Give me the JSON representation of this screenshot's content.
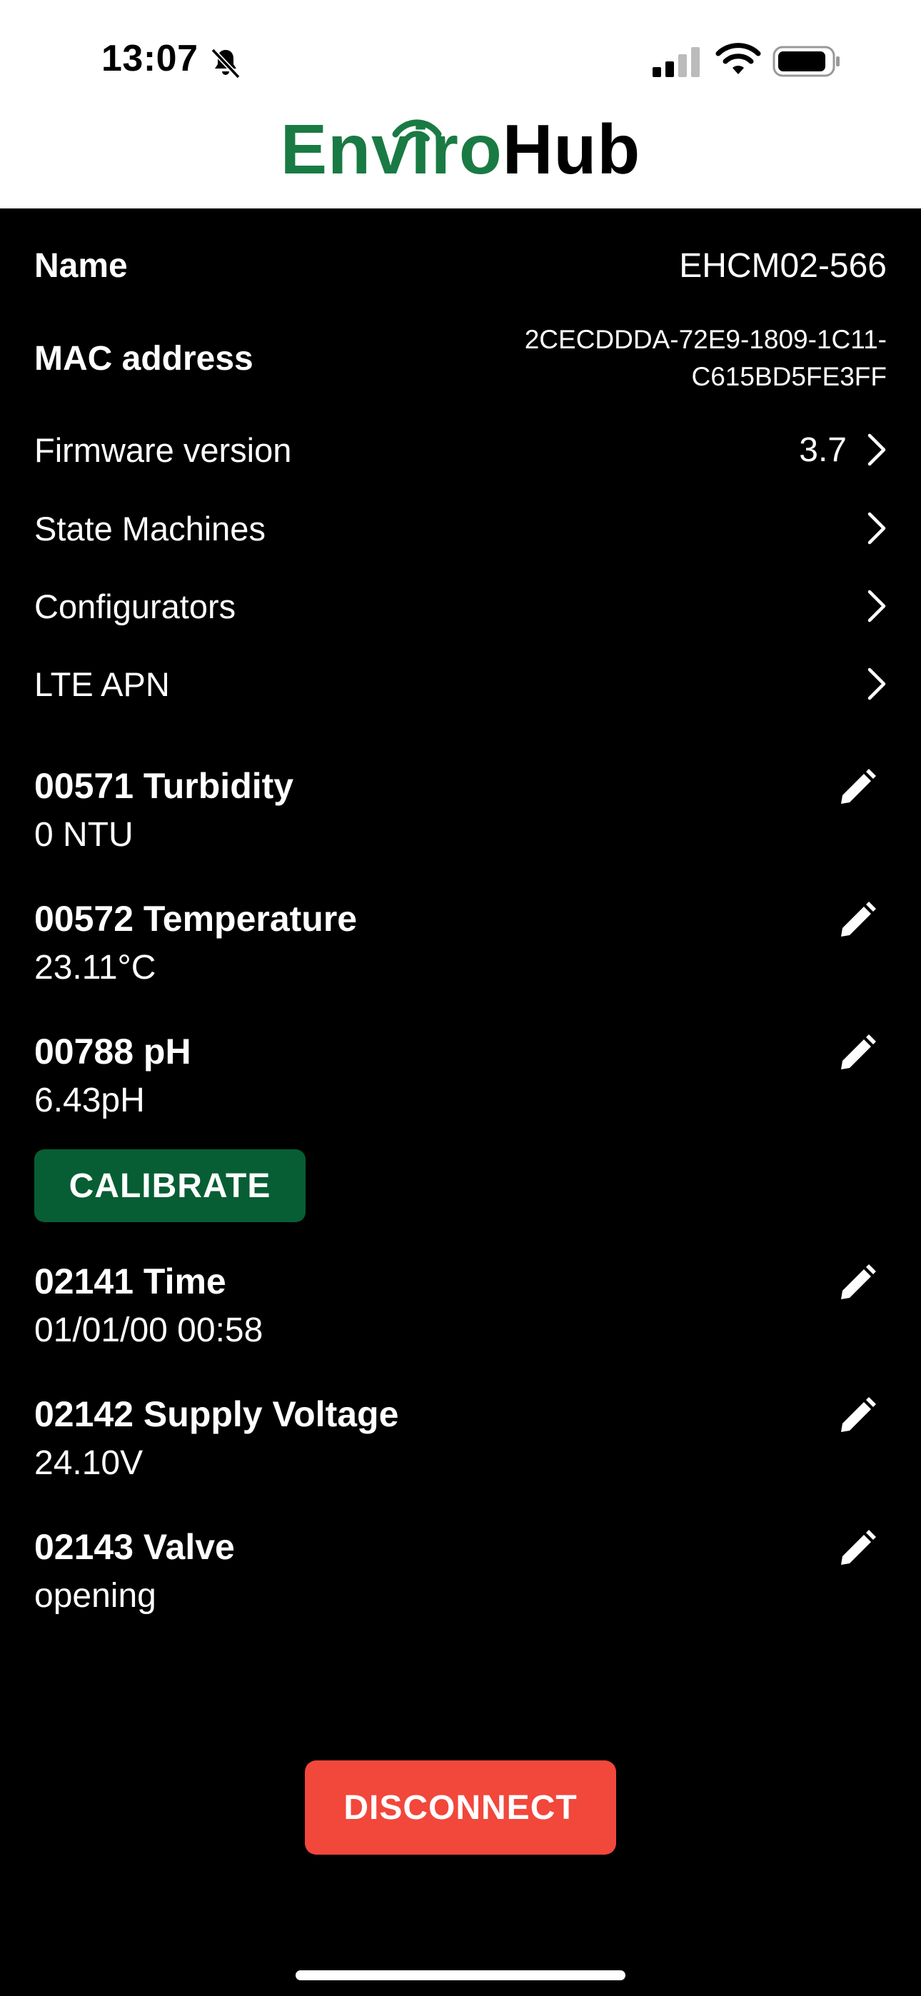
{
  "status_bar": {
    "time": "13:07",
    "icons": [
      "bell-slash-icon",
      "cellular-signal-icon",
      "wifi-icon",
      "battery-icon"
    ]
  },
  "header": {
    "logo_part1": "Enviro",
    "logo_part2": "Hub"
  },
  "colors": {
    "brand_green": "#1a7a43",
    "calibrate_bg": "#075e34",
    "disconnect_bg": "#f2473b",
    "background": "#000000"
  },
  "info": {
    "name_label": "Name",
    "name_value": "EHCM02-566",
    "mac_label": "MAC address",
    "mac_value_line1": "2CECDDDA-72E9-1809-1C11-",
    "mac_value_line2": "C615BD5FE3FF",
    "firmware_label": "Firmware version",
    "firmware_value": "3.7",
    "state_machines_label": "State Machines",
    "configurators_label": "Configurators",
    "lte_apn_label": "LTE APN"
  },
  "sensors": [
    {
      "title": "00571 Turbidity",
      "value": "0 NTU"
    },
    {
      "title": "00572 Temperature",
      "value": "23.11°C"
    },
    {
      "title": "00788 pH",
      "value": "6.43pH"
    },
    {
      "title": "02141 Time",
      "value": "01/01/00 00:58"
    },
    {
      "title": "02142 Supply Voltage",
      "value": "24.10V"
    },
    {
      "title": "02143 Valve",
      "value": "opening"
    }
  ],
  "buttons": {
    "calibrate": "CALIBRATE",
    "disconnect": "DISCONNECT"
  }
}
